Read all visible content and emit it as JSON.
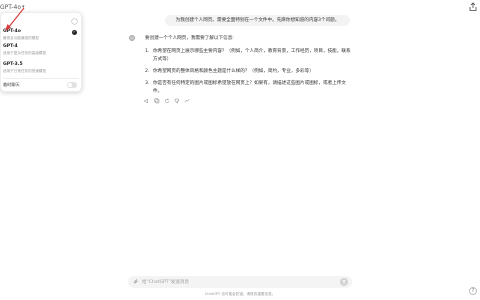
{
  "header": {
    "model_label": "GPT-4o",
    "chevron_icon": "chevron-down-icon",
    "share_icon": "share-icon"
  },
  "dropdown": {
    "options": [
      {
        "name": "GPT-4o",
        "desc": "最快且功能最强的模型",
        "selected": true
      },
      {
        "name": "GPT-4",
        "desc": "适用于复杂任务的高级模型",
        "selected": false
      },
      {
        "name": "GPT-3.5",
        "desc": "适用于日常任务的快速模型",
        "selected": false
      }
    ],
    "temporary_chat_label": "临时聊天",
    "temporary_chat_on": false
  },
  "chat": {
    "user_message": "为我创建个人网页。需要全面特别在一个文件中。先麻你想知道的内容3个问题。",
    "reply_intro": "要创建一个个人网页，我需要了解以下信息:",
    "reply_items": [
      "你希望在网页上展示哪些主要内容？（例如，个人简介，教育背景，工作经历，项目，技能，联系方式等）",
      "你希望网页的整体风格和颜色主题是什么样的？（例如，简约，专业，多彩等）",
      "你是否有任何特定的图片或图标希望放在网页上？如果有，请描述这些图片或图标，或者上传文件。"
    ],
    "action_icons": [
      "speaker-icon",
      "copy-icon",
      "regenerate-icon",
      "thumbs-down-icon",
      "more-icon"
    ]
  },
  "composer": {
    "placeholder": "给\"ChatGPT\"发送消息",
    "value": "",
    "disclaimer": "ChatGPT 也可能会犯错。请核查重要信息。",
    "help_label": "?"
  },
  "colors": {
    "bubble": "#f3f3f3",
    "send": "#d2d2d2",
    "annotation_arrow": "#d93a3a"
  }
}
